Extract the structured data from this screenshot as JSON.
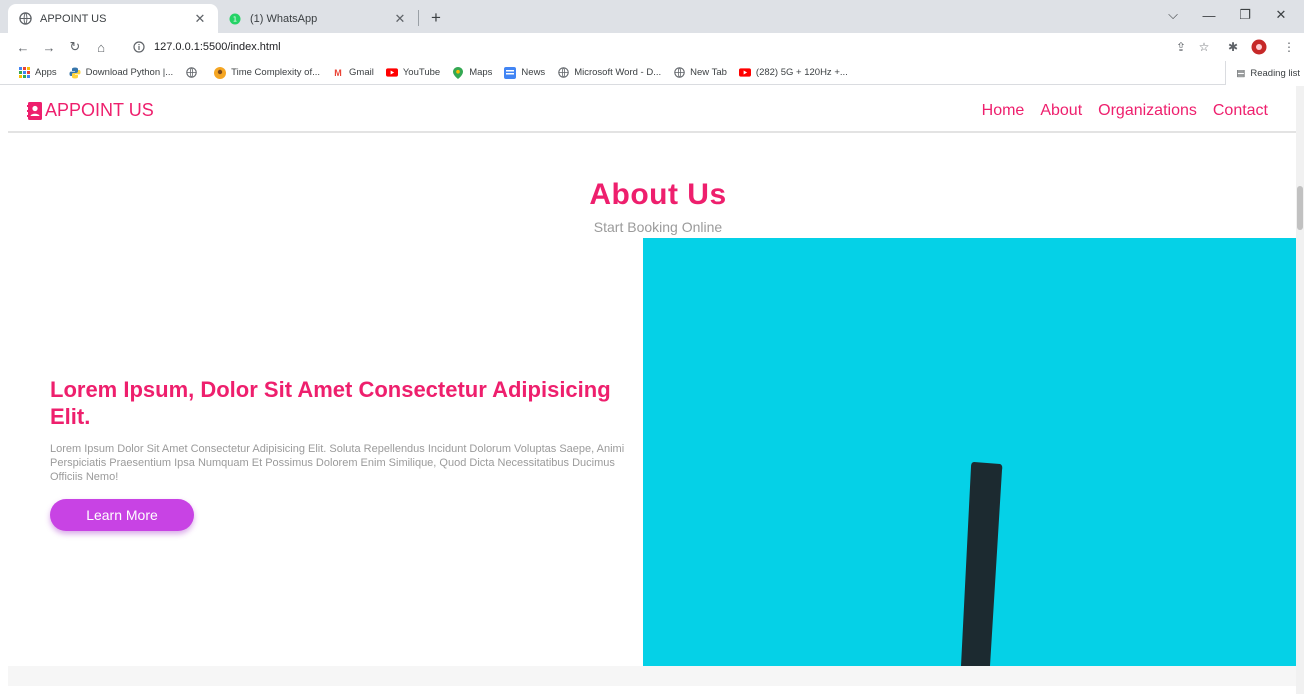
{
  "browser": {
    "tabs": [
      {
        "title": "APPOINT US",
        "active": true
      },
      {
        "title": "(1) WhatsApp",
        "active": false
      }
    ],
    "url": "127.0.0.1:5500/index.html",
    "bookmarks": [
      {
        "label": "Apps",
        "icon": "apps-grid-icon"
      },
      {
        "label": "Download Python |...",
        "icon": "python-icon"
      },
      {
        "label": "",
        "icon": "globe-icon"
      },
      {
        "label": "Time Complexity of...",
        "icon": "avatar-icon"
      },
      {
        "label": "Gmail",
        "icon": "gmail-icon"
      },
      {
        "label": "YouTube",
        "icon": "youtube-icon"
      },
      {
        "label": "Maps",
        "icon": "maps-icon"
      },
      {
        "label": "News",
        "icon": "news-icon"
      },
      {
        "label": "Microsoft Word - D...",
        "icon": "globe-icon"
      },
      {
        "label": "New Tab",
        "icon": "globe-icon"
      },
      {
        "label": "(282) 5G + 120Hz +...",
        "icon": "youtube-icon"
      }
    ],
    "reading_list": "Reading list"
  },
  "site": {
    "logo_text": "APPOINT US",
    "nav": [
      "Home",
      "About",
      "Organizations",
      "Contact"
    ],
    "about": {
      "title": "About Us",
      "subtitle": "Start Booking Online"
    },
    "hero": {
      "heading": "Lorem Ipsum, Dolor Sit Amet Consectetur Adipisicing Elit.",
      "body": "Lorem Ipsum Dolor Sit Amet Consectetur Adipisicing Elit. Soluta Repellendus Incidunt Dolorum Voluptas Saepe, Animi Perspiciatis Praesentium Ipsa Numquam Et Possimus Dolorem Enim Similique, Quod Dicta Necessitatibus Ducimus Officiis Nemo!",
      "button": "Learn More"
    }
  },
  "colors": {
    "accent": "#ee1f6d",
    "button": "#c843e4",
    "image_bg": "#05d1e7",
    "muted_text": "#9b9b9b"
  }
}
